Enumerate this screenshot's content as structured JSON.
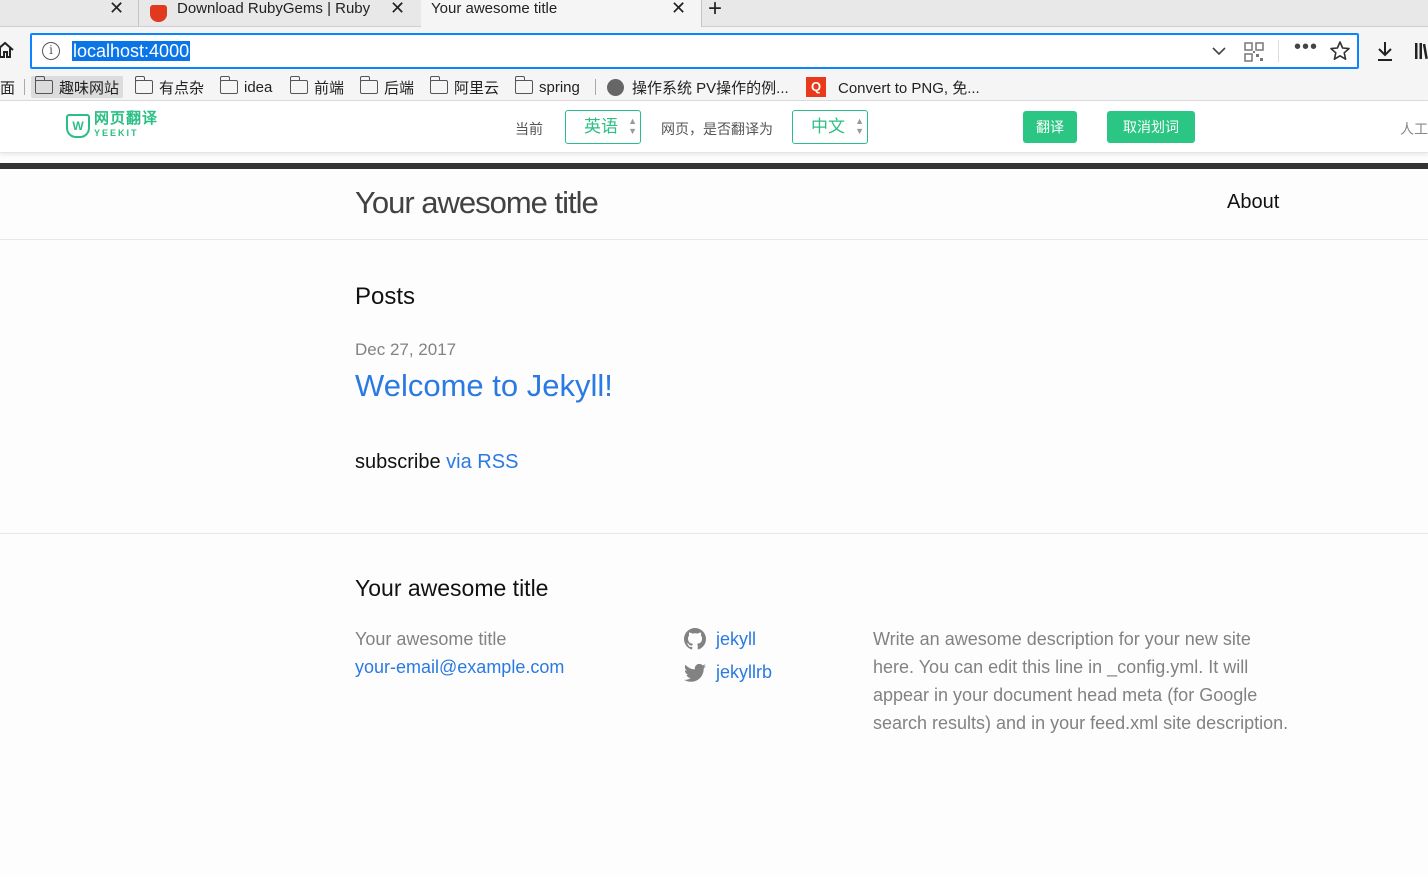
{
  "browser": {
    "tabs": [
      {
        "label": "",
        "close": "✕"
      },
      {
        "label": "Download RubyGems | Ruby",
        "close": "✕"
      },
      {
        "label": "Your awesome title",
        "close": "✕"
      }
    ],
    "new_tab": "+",
    "url": "localhost:4000",
    "bookmarks": [
      {
        "label": "面"
      },
      {
        "label": "趣味网站"
      },
      {
        "label": "有点杂"
      },
      {
        "label": "idea"
      },
      {
        "label": "前端"
      },
      {
        "label": "后端"
      },
      {
        "label": "阿里云"
      },
      {
        "label": "spring"
      },
      {
        "label": "操作系统 PV操作的例..."
      },
      {
        "label": "Convert to PNG, 免..."
      }
    ]
  },
  "translator": {
    "logo_text": "网页翻译",
    "logo_sub": "YEEKIT",
    "current_label": "当前",
    "source_lang": "英语",
    "question_label": "网页，是否翻译为",
    "target_lang": "中文",
    "translate_button": "翻译",
    "cancel_button": "取消划词",
    "manual_label": "人工"
  },
  "site": {
    "title": "Your awesome title",
    "nav": {
      "about": "About"
    },
    "posts_heading": "Posts",
    "posts": [
      {
        "date": "Dec 27, 2017",
        "title": "Welcome to Jekyll!"
      }
    ],
    "subscribe_text": "subscribe",
    "subscribe_link": "via RSS",
    "footer": {
      "title": "Your awesome title",
      "name": "Your awesome title",
      "email": "your-email@example.com",
      "github": "jekyll",
      "twitter": "jekyllrb",
      "description": "Write an awesome description for your new site here. You can edit this line in _config.yml. It will appear in your document head meta (for Google search results) and in your feed.xml site description."
    }
  },
  "colors": {
    "link": "#2a7ae2",
    "translator_green": "#2bc684",
    "url_highlight": "#0a75e8"
  }
}
